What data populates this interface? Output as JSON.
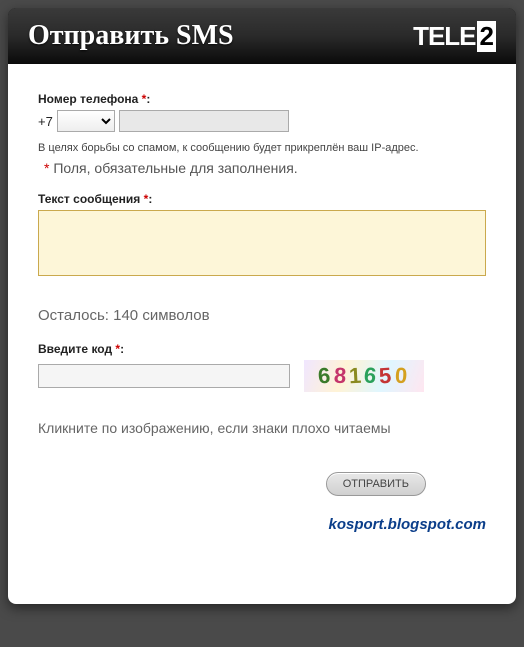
{
  "header": {
    "title": "Отправить SMS",
    "logo_text": "TELE",
    "logo_suffix": "2"
  },
  "form": {
    "phone_label": "Номер телефона ",
    "phone_prefix": "+7",
    "phone_select_value": "",
    "phone_value": "",
    "spam_note": "В целях борьбы со спамом, к сообщению будет прикреплён ваш IP-адрес.",
    "required_note": "Поля, обязательные для заполнения.",
    "message_label": "Текст сообщения ",
    "message_value": "",
    "remaining": "Осталось: 140 символов",
    "captcha_label": "Введите код ",
    "captcha_value": "",
    "captcha_image_text": "681650",
    "captcha_hint": "Кликните по изображению, если знаки плохо читаемы",
    "submit_label": "ОТПРАВИТЬ",
    "colon": ":",
    "asterisk": "*"
  },
  "footer": {
    "link": "kosport.blogspot.com"
  }
}
